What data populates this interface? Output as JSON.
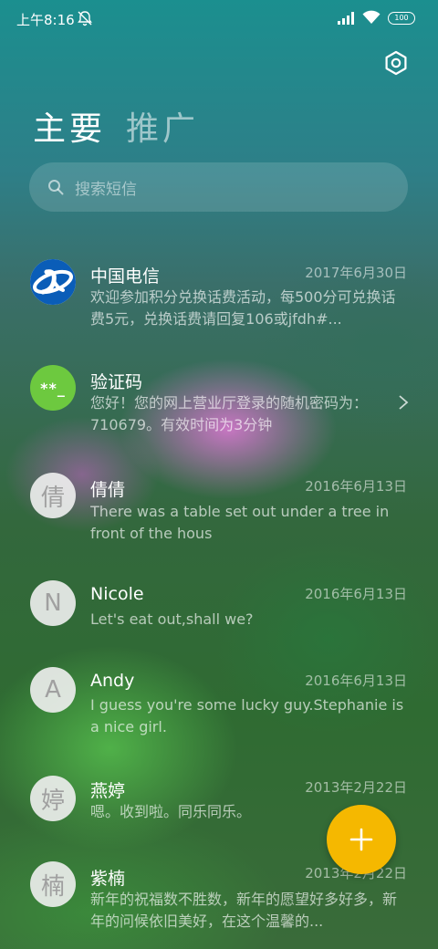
{
  "status_bar": {
    "time": "上午8:16",
    "battery": "100"
  },
  "tabs": [
    {
      "label": "主要",
      "active": true
    },
    {
      "label": "推广",
      "active": false
    }
  ],
  "search": {
    "placeholder": "搜索短信"
  },
  "messages": [
    {
      "sender": "中国电信",
      "date": "2017年6月30日",
      "preview": "欢迎参加积分兑换话费活动，每500分可兑换话费5元，兑换话费请回复106或jfdh#...",
      "avatar_icon": "china-telecom-logo"
    },
    {
      "sender": "验证码",
      "date": "",
      "preview": "您好！您的网上营业厅登录的随机密码为：710679。有效时间为3分钟",
      "avatar_text": "**_"
    },
    {
      "sender": "倩倩",
      "date": "2016年6月13日",
      "preview": "There was a table set out under a tree in front of the hous",
      "avatar_text": "倩"
    },
    {
      "sender": "Nicole",
      "date": "2016年6月13日",
      "preview": "Let's eat out,shall we?",
      "avatar_text": "N"
    },
    {
      "sender": "Andy",
      "date": "2016年6月13日",
      "preview": "I guess you're some lucky guy.Stephanie is a nice girl.",
      "avatar_text": "A"
    },
    {
      "sender": "燕婷",
      "date": "2013年2月22日",
      "preview": "嗯。收到啦。同乐同乐。",
      "avatar_text": "婷"
    },
    {
      "sender": "紫楠",
      "date": "2013年2月22日",
      "preview": "新年的祝福数不胜数，新年的愿望好多好多，新年的问候依旧美好，在这个温馨的...",
      "avatar_text": "楠"
    }
  ],
  "colors": {
    "fab": "#f5b800",
    "verification_avatar": "#6dc93f",
    "telecom_blue": "#0a5db8"
  }
}
